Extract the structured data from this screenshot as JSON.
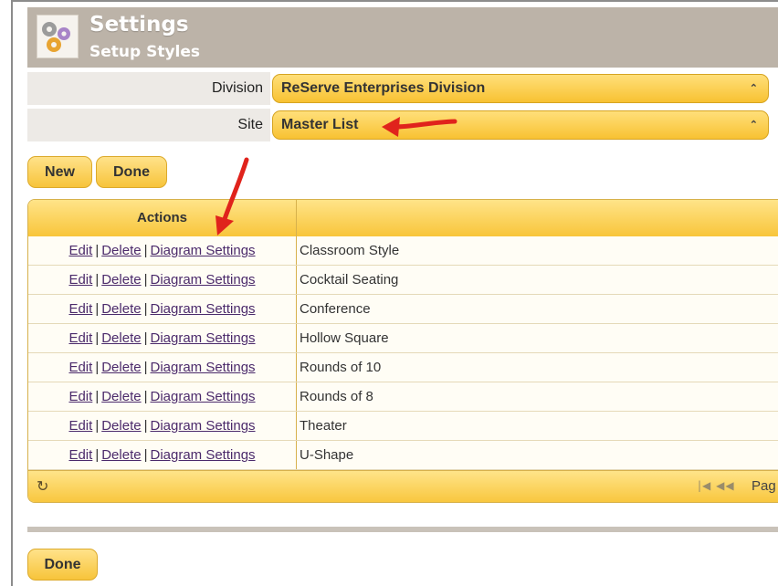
{
  "header": {
    "title": "Settings",
    "subtitle": "Setup Styles",
    "icon": "gears-icon"
  },
  "filters": {
    "division_label": "Division",
    "division_value": "ReServe Enterprises Division",
    "site_label": "Site",
    "site_value": "Master List"
  },
  "toolbar": {
    "new_label": "New",
    "done_label": "Done"
  },
  "grid": {
    "actions_header": "Actions",
    "name_header": "",
    "edit_label": "Edit",
    "delete_label": "Delete",
    "diagram_label": "Diagram Settings",
    "separator": "|",
    "rows": [
      {
        "name": "Classroom Style"
      },
      {
        "name": "Cocktail Seating"
      },
      {
        "name": "Conference"
      },
      {
        "name": "Hollow Square"
      },
      {
        "name": "Rounds of 10"
      },
      {
        "name": "Rounds of 8"
      },
      {
        "name": "Theater"
      },
      {
        "name": "U-Shape"
      }
    ],
    "footer": {
      "refresh_icon": "refresh-icon",
      "pager_label": "Pag"
    }
  },
  "footer_button": "Done",
  "colors": {
    "header_bg": "#bcb3a8",
    "button_gold": "#f8c53a",
    "link": "#4b2a6b",
    "arrow": "#e0231c"
  }
}
